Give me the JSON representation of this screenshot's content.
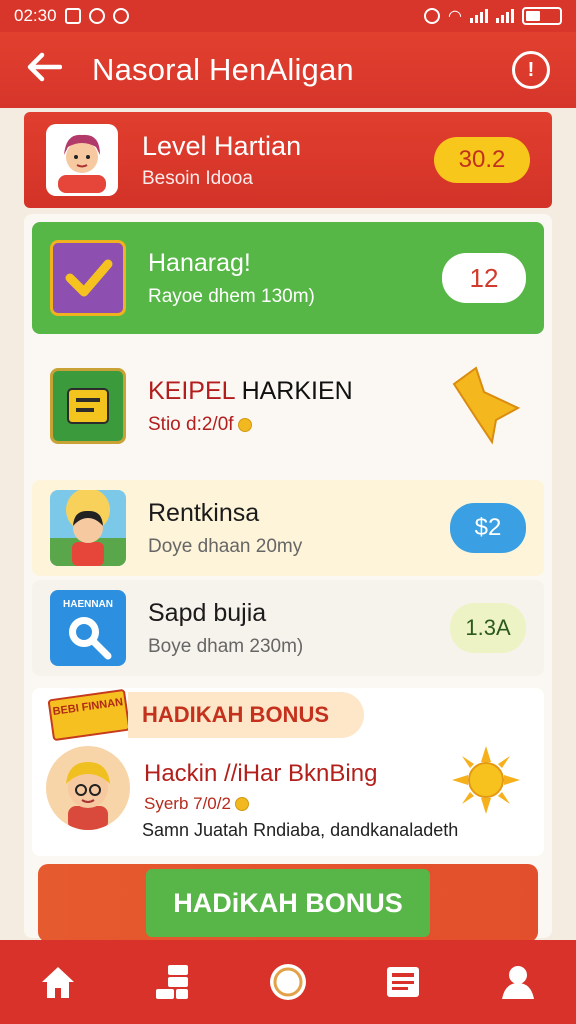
{
  "status": {
    "time": "02:30"
  },
  "appbar": {
    "title": "Nasoral HenAligan"
  },
  "level": {
    "title": "Level Hartian",
    "subtitle": "Besoin Idooa",
    "coins": "30.2"
  },
  "tasks": [
    {
      "title": "Hanarag!",
      "subtitle": "Rayoe dhem 130m)",
      "badge": "12"
    },
    {
      "title_red": "KEIPEL",
      "title_black": " HARKIEN",
      "subtitle": "Stio d:2/0f"
    },
    {
      "title": "Rentkinsa",
      "subtitle": "Doye dhaan 20my",
      "badge": "$2"
    },
    {
      "title": "Sapd bujia",
      "subtitle": "Boye dham 230m)",
      "badge": "1.3A",
      "thumb_label": "HAENNAN"
    }
  ],
  "bonus": {
    "tag": "BEBI FINNAN",
    "header": "HADIKAH BONUS",
    "title_red": "Hackin",
    "title_black": " //iHar BknBing",
    "subtitle": "Syerb 7/0/2",
    "description": "Samn Juatah Rndiaba, dandkanaladeth",
    "button": "HADiKAH BONUS"
  },
  "nav": [
    "home-icon",
    "gift-boxes-icon",
    "circle-icon",
    "news-icon",
    "profile-icon"
  ],
  "colors": {
    "primary_red": "#d9362b",
    "green": "#56b746",
    "gold": "#f7c71c",
    "blue": "#3aa0e3"
  }
}
